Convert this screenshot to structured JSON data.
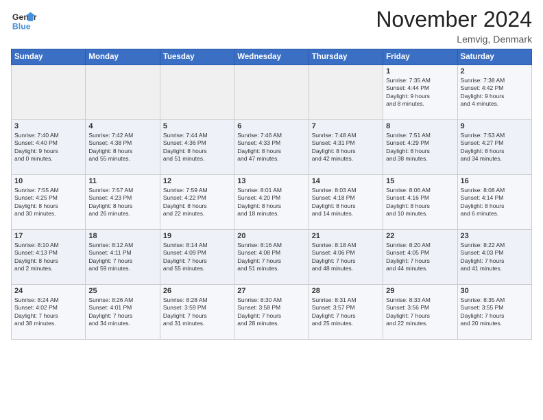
{
  "header": {
    "logo_line1": "General",
    "logo_line2": "Blue",
    "title": "November 2024",
    "location": "Lemvig, Denmark"
  },
  "weekdays": [
    "Sunday",
    "Monday",
    "Tuesday",
    "Wednesday",
    "Thursday",
    "Friday",
    "Saturday"
  ],
  "weeks": [
    [
      {
        "day": "",
        "info": ""
      },
      {
        "day": "",
        "info": ""
      },
      {
        "day": "",
        "info": ""
      },
      {
        "day": "",
        "info": ""
      },
      {
        "day": "",
        "info": ""
      },
      {
        "day": "1",
        "info": "Sunrise: 7:35 AM\nSunset: 4:44 PM\nDaylight: 9 hours\nand 8 minutes."
      },
      {
        "day": "2",
        "info": "Sunrise: 7:38 AM\nSunset: 4:42 PM\nDaylight: 9 hours\nand 4 minutes."
      }
    ],
    [
      {
        "day": "3",
        "info": "Sunrise: 7:40 AM\nSunset: 4:40 PM\nDaylight: 9 hours\nand 0 minutes."
      },
      {
        "day": "4",
        "info": "Sunrise: 7:42 AM\nSunset: 4:38 PM\nDaylight: 8 hours\nand 55 minutes."
      },
      {
        "day": "5",
        "info": "Sunrise: 7:44 AM\nSunset: 4:36 PM\nDaylight: 8 hours\nand 51 minutes."
      },
      {
        "day": "6",
        "info": "Sunrise: 7:46 AM\nSunset: 4:33 PM\nDaylight: 8 hours\nand 47 minutes."
      },
      {
        "day": "7",
        "info": "Sunrise: 7:48 AM\nSunset: 4:31 PM\nDaylight: 8 hours\nand 42 minutes."
      },
      {
        "day": "8",
        "info": "Sunrise: 7:51 AM\nSunset: 4:29 PM\nDaylight: 8 hours\nand 38 minutes."
      },
      {
        "day": "9",
        "info": "Sunrise: 7:53 AM\nSunset: 4:27 PM\nDaylight: 8 hours\nand 34 minutes."
      }
    ],
    [
      {
        "day": "10",
        "info": "Sunrise: 7:55 AM\nSunset: 4:25 PM\nDaylight: 8 hours\nand 30 minutes."
      },
      {
        "day": "11",
        "info": "Sunrise: 7:57 AM\nSunset: 4:23 PM\nDaylight: 8 hours\nand 26 minutes."
      },
      {
        "day": "12",
        "info": "Sunrise: 7:59 AM\nSunset: 4:22 PM\nDaylight: 8 hours\nand 22 minutes."
      },
      {
        "day": "13",
        "info": "Sunrise: 8:01 AM\nSunset: 4:20 PM\nDaylight: 8 hours\nand 18 minutes."
      },
      {
        "day": "14",
        "info": "Sunrise: 8:03 AM\nSunset: 4:18 PM\nDaylight: 8 hours\nand 14 minutes."
      },
      {
        "day": "15",
        "info": "Sunrise: 8:06 AM\nSunset: 4:16 PM\nDaylight: 8 hours\nand 10 minutes."
      },
      {
        "day": "16",
        "info": "Sunrise: 8:08 AM\nSunset: 4:14 PM\nDaylight: 8 hours\nand 6 minutes."
      }
    ],
    [
      {
        "day": "17",
        "info": "Sunrise: 8:10 AM\nSunset: 4:13 PM\nDaylight: 8 hours\nand 2 minutes."
      },
      {
        "day": "18",
        "info": "Sunrise: 8:12 AM\nSunset: 4:11 PM\nDaylight: 7 hours\nand 59 minutes."
      },
      {
        "day": "19",
        "info": "Sunrise: 8:14 AM\nSunset: 4:09 PM\nDaylight: 7 hours\nand 55 minutes."
      },
      {
        "day": "20",
        "info": "Sunrise: 8:16 AM\nSunset: 4:08 PM\nDaylight: 7 hours\nand 51 minutes."
      },
      {
        "day": "21",
        "info": "Sunrise: 8:18 AM\nSunset: 4:06 PM\nDaylight: 7 hours\nand 48 minutes."
      },
      {
        "day": "22",
        "info": "Sunrise: 8:20 AM\nSunset: 4:05 PM\nDaylight: 7 hours\nand 44 minutes."
      },
      {
        "day": "23",
        "info": "Sunrise: 8:22 AM\nSunset: 4:03 PM\nDaylight: 7 hours\nand 41 minutes."
      }
    ],
    [
      {
        "day": "24",
        "info": "Sunrise: 8:24 AM\nSunset: 4:02 PM\nDaylight: 7 hours\nand 38 minutes."
      },
      {
        "day": "25",
        "info": "Sunrise: 8:26 AM\nSunset: 4:01 PM\nDaylight: 7 hours\nand 34 minutes."
      },
      {
        "day": "26",
        "info": "Sunrise: 8:28 AM\nSunset: 3:59 PM\nDaylight: 7 hours\nand 31 minutes."
      },
      {
        "day": "27",
        "info": "Sunrise: 8:30 AM\nSunset: 3:58 PM\nDaylight: 7 hours\nand 28 minutes."
      },
      {
        "day": "28",
        "info": "Sunrise: 8:31 AM\nSunset: 3:57 PM\nDaylight: 7 hours\nand 25 minutes."
      },
      {
        "day": "29",
        "info": "Sunrise: 8:33 AM\nSunset: 3:56 PM\nDaylight: 7 hours\nand 22 minutes."
      },
      {
        "day": "30",
        "info": "Sunrise: 8:35 AM\nSunset: 3:55 PM\nDaylight: 7 hours\nand 20 minutes."
      }
    ]
  ]
}
